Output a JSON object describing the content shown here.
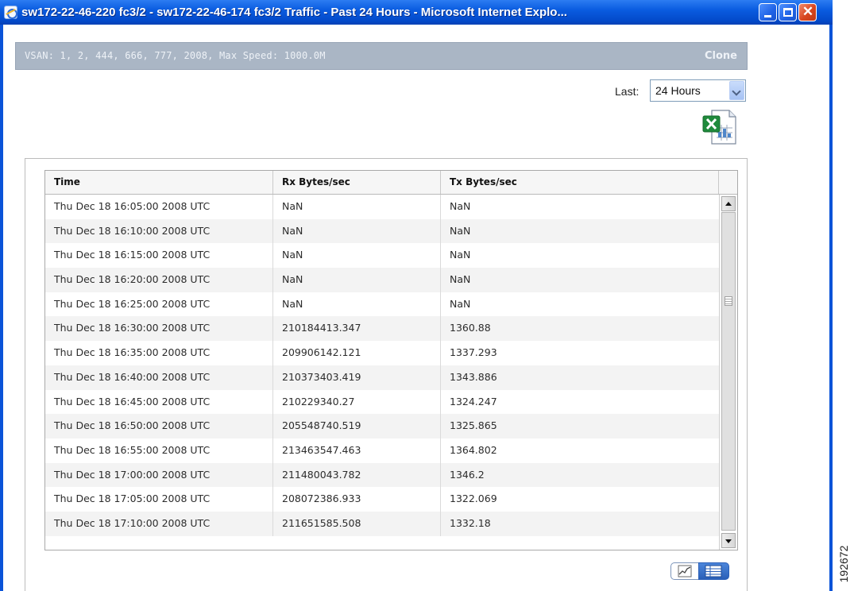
{
  "window": {
    "title": "sw172-22-46-220 fc3/2 - sw172-22-46-174 fc3/2 Traffic - Past 24 Hours - Microsoft Internet Explo...",
    "close_glyph": "✕"
  },
  "info_bar": {
    "text": "VSAN: 1, 2, 444, 666, 777, 2008, Max Speed: 1000.0M",
    "clone_label": "Clone"
  },
  "range_selector": {
    "label": "Last:",
    "selected": "24 Hours"
  },
  "table": {
    "columns": [
      "Time",
      "Rx Bytes/sec",
      "Tx Bytes/sec"
    ],
    "rows": [
      [
        "Thu Dec 18 16:05:00 2008 UTC",
        "NaN",
        "NaN"
      ],
      [
        "Thu Dec 18 16:10:00 2008 UTC",
        "NaN",
        "NaN"
      ],
      [
        "Thu Dec 18 16:15:00 2008 UTC",
        "NaN",
        "NaN"
      ],
      [
        "Thu Dec 18 16:20:00 2008 UTC",
        "NaN",
        "NaN"
      ],
      [
        "Thu Dec 18 16:25:00 2008 UTC",
        "NaN",
        "NaN"
      ],
      [
        "Thu Dec 18 16:30:00 2008 UTC",
        "210184413.347",
        "1360.88"
      ],
      [
        "Thu Dec 18 16:35:00 2008 UTC",
        "209906142.121",
        "1337.293"
      ],
      [
        "Thu Dec 18 16:40:00 2008 UTC",
        "210373403.419",
        "1343.886"
      ],
      [
        "Thu Dec 18 16:45:00 2008 UTC",
        "210229340.27",
        "1324.247"
      ],
      [
        "Thu Dec 18 16:50:00 2008 UTC",
        "205548740.519",
        "1325.865"
      ],
      [
        "Thu Dec 18 16:55:00 2008 UTC",
        "213463547.463",
        "1364.802"
      ],
      [
        "Thu Dec 18 17:00:00 2008 UTC",
        "211480043.782",
        "1346.2"
      ],
      [
        "Thu Dec 18 17:05:00 2008 UTC",
        "208072386.933",
        "1322.069"
      ],
      [
        "Thu Dec 18 17:10:00 2008 UTC",
        "211651585.508",
        "1332.18"
      ]
    ]
  },
  "figure_number": "192672",
  "icons": {
    "app": "internet-explorer-icon",
    "export": "excel-export-icon",
    "chart_view": "line-chart-icon",
    "table_view": "table-icon"
  },
  "colors": {
    "titlebar": "#0a5ce0",
    "info_bar": "#aab6c5",
    "close_button": "#d8461f",
    "table_view_active": "#2a5fb8"
  }
}
